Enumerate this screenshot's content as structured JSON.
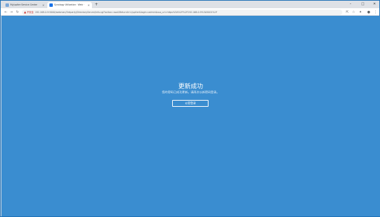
{
  "browser": {
    "tabs": [
      {
        "title": "MyJupiter Service Center",
        "favicon_color": "#7aa7d9",
        "close": "×"
      },
      {
        "title": "Synology Utilization · Web ·",
        "favicon_color": "#1a73e8",
        "close": "×"
      }
    ],
    "new_tab": "+",
    "window_controls": {
      "minimize": "–",
      "maximize": "□",
      "close": "✕"
    },
    "nav": {
      "back": "←",
      "forward": "→",
      "reload": "↻"
    },
    "address": {
      "warning_icon": "▲",
      "insecure_label": "不安全",
      "url": "192.168.0.9:5000/webman/3rdparty/DirectoryServer/info.cgi?action=sso&ReturnUrl=Jupiter&login=admin&sso_url=https%3A%2F%2F192.168.0.9%3A5001%2F"
    },
    "toolbar_icons": {
      "share": "⇱",
      "star": "☆",
      "extensions": "✦",
      "profile": "●",
      "menu": "⋮"
    }
  },
  "page": {
    "headline": "更新成功",
    "message": "您的密码已成功更新。请再次以新密码登录。",
    "relogin_button": "以密登录"
  },
  "colors": {
    "content_background": "#3a8dd0",
    "tab_strip": "#dee1e6",
    "insecure": "#c5221f"
  }
}
